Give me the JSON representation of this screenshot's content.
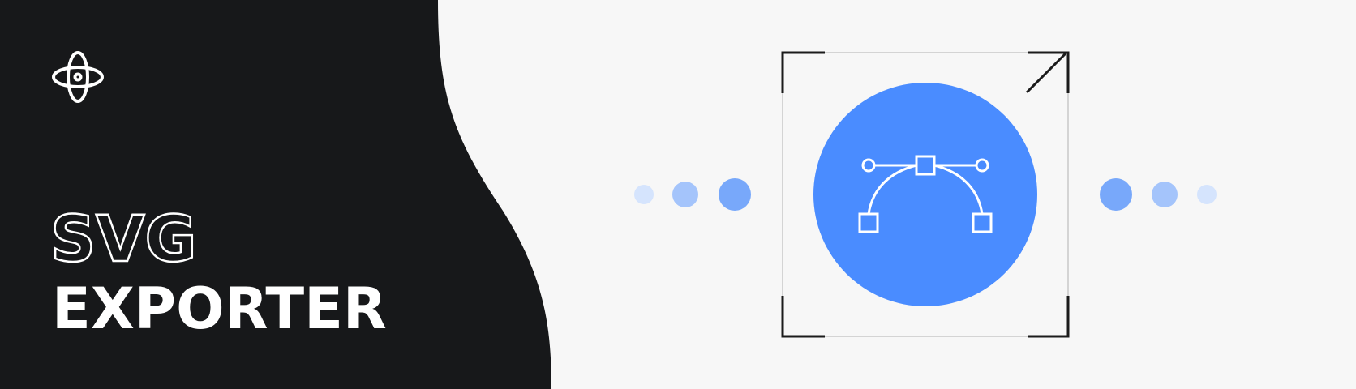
{
  "banner": {
    "title_line1": "SVG",
    "title_line2": "EXPORTER"
  },
  "colors": {
    "dark_panel": "#17181a",
    "light_bg": "#f7f7f7",
    "accent_blue": "#4a8cff",
    "dot_light": "#d5e4fd",
    "dot_mid": "#a4c4fb",
    "dot_strong": "#78a8fa",
    "frame": "#1b1b1b",
    "white": "#ffffff"
  },
  "icons": {
    "logo": "orbit-logo-icon",
    "main": "bezier-curve-icon",
    "resize": "resize-arrow-icon"
  }
}
